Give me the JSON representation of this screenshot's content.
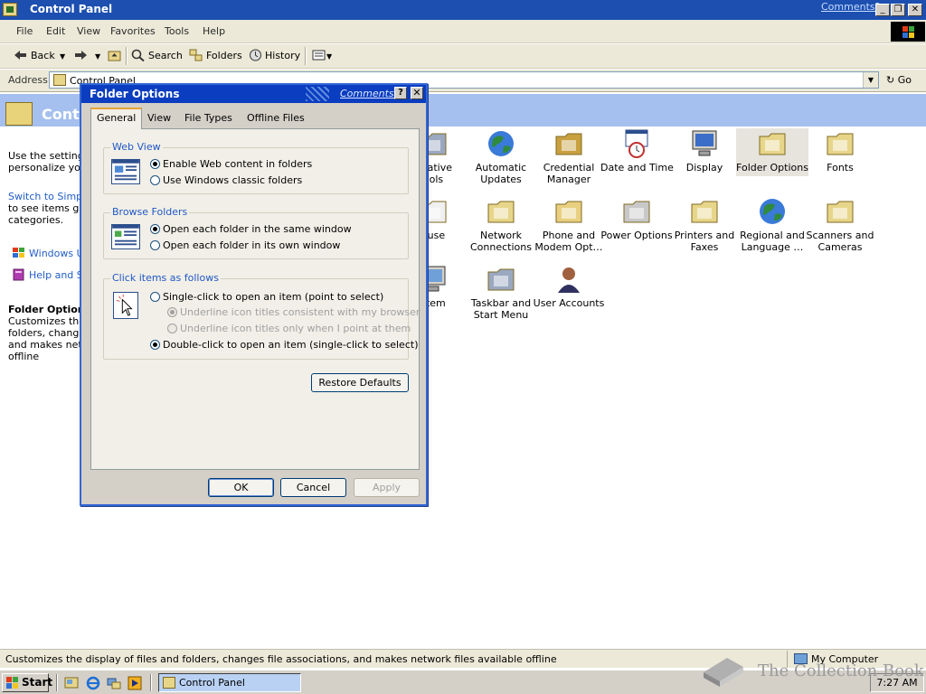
{
  "window": {
    "title": "Control Panel",
    "comments_link": "Comments?",
    "minimize_glyph": "_",
    "restore_glyph": "❐",
    "close_glyph": "✕"
  },
  "menu": [
    "File",
    "Edit",
    "View",
    "Favorites",
    "Tools",
    "Help"
  ],
  "toolbar": {
    "back": "Back",
    "search": "Search",
    "folders": "Folders",
    "history": "History"
  },
  "address": {
    "label": "Address",
    "value": "Control Panel",
    "go": "Go"
  },
  "task_pane": {
    "title": "Control Panel",
    "intro_lines": [
      "Use the settings",
      "personalize your"
    ],
    "switch_lines": [
      "Switch to Simple",
      "to see items grou",
      "categories."
    ],
    "links": [
      "Windows Up",
      "Help and Su"
    ],
    "selected_title": "Folder Options",
    "selected_desc_lines": [
      "Customizes the d",
      "folders, changes",
      "and makes netw",
      "offline"
    ]
  },
  "items": [
    {
      "label": "Administrative Tools",
      "lines": [
        "strative",
        "ools"
      ],
      "icon": "admin-tools-icon"
    },
    {
      "label": "Automatic Updates",
      "lines": [
        "Automatic",
        "Updates"
      ],
      "icon": "globe-icon"
    },
    {
      "label": "Credential Manager",
      "lines": [
        "Credential",
        "Manager"
      ],
      "icon": "keys-icon"
    },
    {
      "label": "Date and Time",
      "lines": [
        "Date and Time"
      ],
      "icon": "calendar-clock-icon"
    },
    {
      "label": "Display",
      "lines": [
        "Display"
      ],
      "icon": "monitor-icon"
    },
    {
      "label": "Folder Options",
      "lines": [
        "Folder Options"
      ],
      "icon": "folder-options-icon"
    },
    {
      "label": "Fonts",
      "lines": [
        "Fonts"
      ],
      "icon": "fonts-folder-icon"
    },
    {
      "label": "Mouse",
      "lines": [
        "ouse"
      ],
      "icon": "mouse-icon"
    },
    {
      "label": "Network Connections",
      "lines": [
        "Network",
        "Connections"
      ],
      "icon": "network-folder-icon"
    },
    {
      "label": "Phone and Modem Options",
      "lines": [
        "Phone and",
        "Modem Opt…"
      ],
      "icon": "phone-icon"
    },
    {
      "label": "Power Options",
      "lines": [
        "Power Options"
      ],
      "icon": "power-plug-icon"
    },
    {
      "label": "Printers and Faxes",
      "lines": [
        "Printers and",
        "Faxes"
      ],
      "icon": "printer-folder-icon"
    },
    {
      "label": "Regional and Language Options",
      "lines": [
        "Regional and",
        "Language …"
      ],
      "icon": "globe-icon"
    },
    {
      "label": "Scanners and Cameras",
      "lines": [
        "Scanners and",
        "Cameras"
      ],
      "icon": "camera-folder-icon"
    },
    {
      "label": "System",
      "lines": [
        "stem"
      ],
      "icon": "computer-icon"
    },
    {
      "label": "Taskbar and Start Menu",
      "lines": [
        "Taskbar and",
        "Start Menu"
      ],
      "icon": "taskbar-icon"
    },
    {
      "label": "User Accounts",
      "lines": [
        "User Accounts"
      ],
      "icon": "user-icon"
    }
  ],
  "status": {
    "text": "Customizes the display of files and folders, changes file associations, and makes network files available offline",
    "zone": "My Computer"
  },
  "taskbar": {
    "start": "Start",
    "task": "Control Panel",
    "clock": "7:27 AM"
  },
  "watermark": "The Collection Book",
  "dialog": {
    "title": "Folder Options",
    "comments": "Comments?",
    "help_glyph": "?",
    "close_glyph": "✕",
    "tabs": [
      "General",
      "View",
      "File Types",
      "Offline Files"
    ],
    "web_view": {
      "title": "Web View",
      "options": [
        "Enable Web content in folders",
        "Use Windows classic folders"
      ],
      "selected": 0
    },
    "browse_folders": {
      "title": "Browse Folders",
      "options": [
        "Open each folder in the same window",
        "Open each folder in its own window"
      ],
      "selected": 0
    },
    "click_items": {
      "title": "Click items as follows",
      "single": "Single-click to open an item (point to select)",
      "sub_options": [
        "Underline icon titles consistent with my browser",
        "Underline icon titles only when I point at them"
      ],
      "double": "Double-click to open an item (single-click to select)",
      "selected": "double"
    },
    "restore_defaults": "Restore Defaults",
    "ok": "OK",
    "cancel": "Cancel",
    "apply": "Apply"
  },
  "colors": {
    "title_bar": "#1c4fb0",
    "dialog_title": "#0a3dbf",
    "link": "#215dc6",
    "group_title": "#2158c7",
    "pane_header": "#a5c0ee"
  }
}
